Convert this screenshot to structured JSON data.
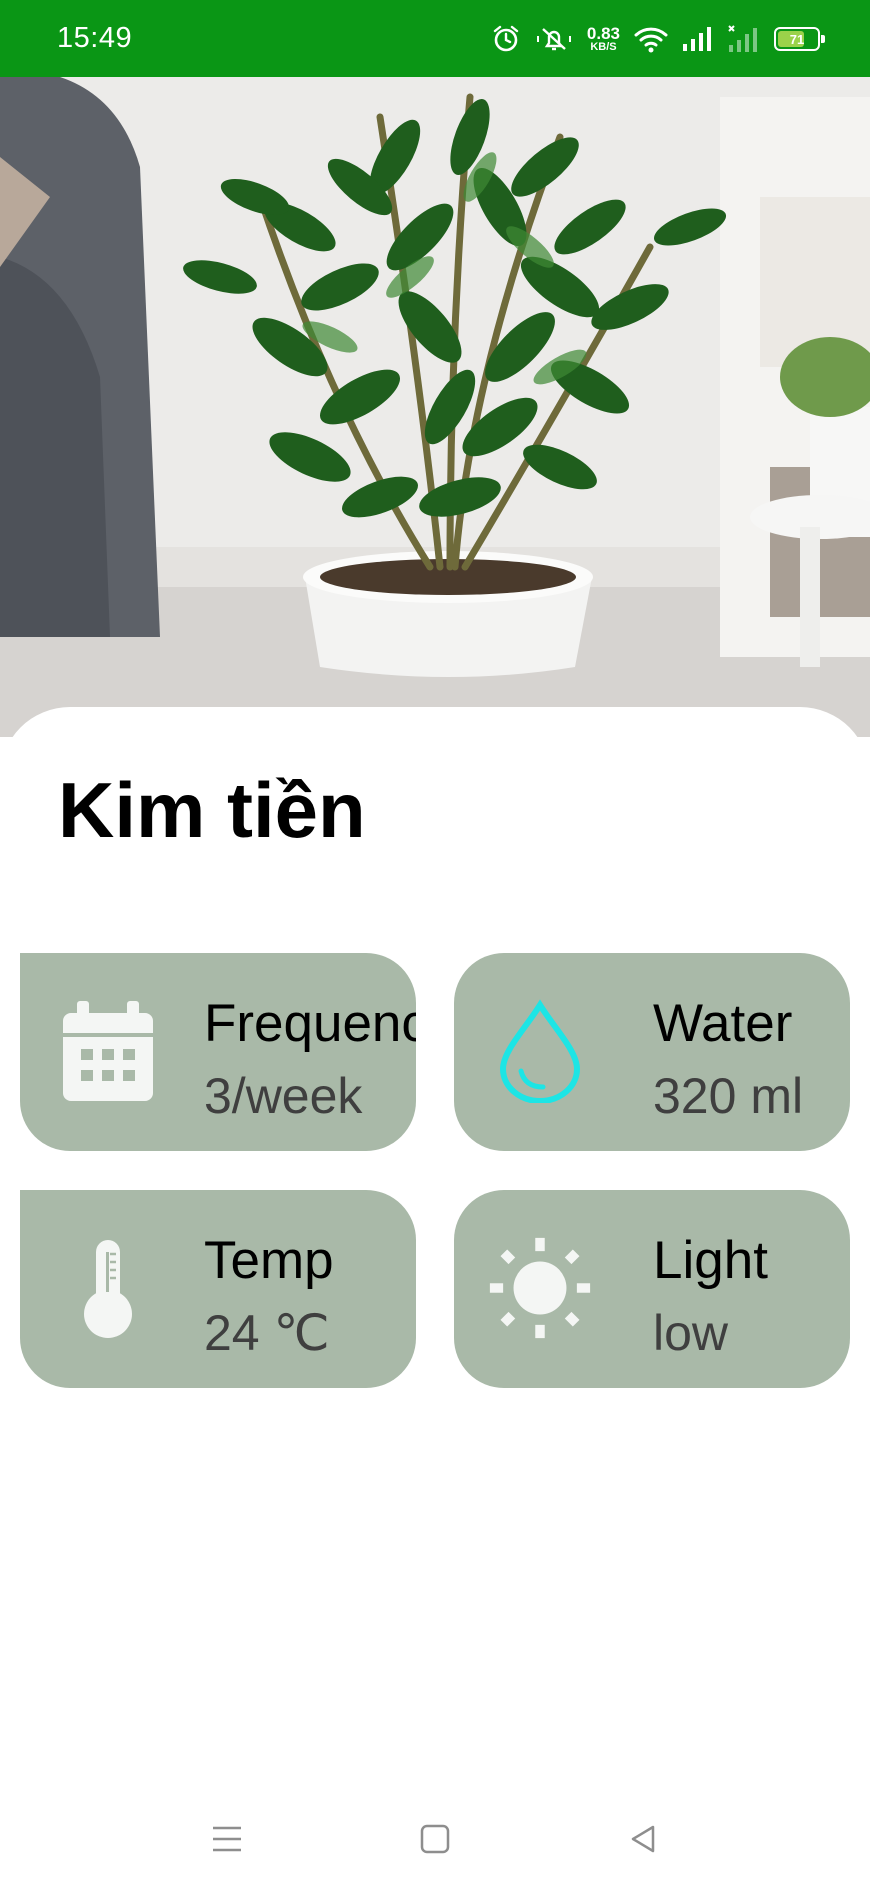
{
  "status_bar": {
    "time": "15:49",
    "net_speed_value": "0.83",
    "net_speed_unit": "KB/S",
    "battery_level": "71",
    "battery_fraction": 0.71,
    "icons": [
      "alarm-icon",
      "mute-icon",
      "wifi-icon",
      "signal-icon",
      "signal-no-service-icon",
      "battery-icon"
    ],
    "background_color": "#0a9615"
  },
  "hero": {
    "icon": "plant-photo"
  },
  "plant": {
    "name": "Kim tiền"
  },
  "cards": {
    "frequency": {
      "label": "Frequency",
      "value": "3/week",
      "icon": "calendar-icon"
    },
    "water": {
      "label": "Water",
      "value": "320 ml",
      "icon": "water-drop-icon",
      "icon_color": "#1de5e5"
    },
    "temp": {
      "label": "Temp",
      "value": "24 ℃",
      "icon": "thermometer-icon"
    },
    "light": {
      "label": "Light",
      "value": "low",
      "icon": "sun-icon"
    },
    "card_color": "#a9b9a8"
  },
  "nav_bar": {
    "items": [
      "menu-icon",
      "home-icon",
      "back-icon"
    ]
  }
}
